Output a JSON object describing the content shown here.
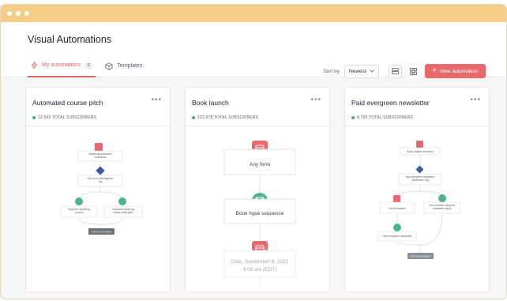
{
  "page": {
    "title": "Visual Automations"
  },
  "tabs": [
    {
      "label": "My automations",
      "count": "6",
      "icon": "lightning-icon",
      "active": true
    },
    {
      "label": "Templates",
      "icon": "cube-icon",
      "active": false
    }
  ],
  "toolbar": {
    "sort_label": "Sort by",
    "sort_value": "Newest",
    "new_button": "New automation",
    "accent": "#e9686b"
  },
  "cards": [
    {
      "title": "Automated course pitch",
      "subscribers": "12,542 TOTAL SUBSCRIBERS",
      "nodes": {
        "n1": "Sketching worksheet",
        "n1b": "download",
        "n2": "Yes I'm a total beginner",
        "n2b": "Tag",
        "n3": "Beginner sketching",
        "n3b": "content",
        "n4": "Advanced sketching",
        "n4b": "course sales pitch",
        "n5": "End of automation"
      }
    },
    {
      "title": "Book launch",
      "subscribers": "123,978 TOTAL SUBSCRIBERS",
      "nodes": {
        "n1": "Any form",
        "n2": "Book hype sequence",
        "n3": "Date: September 8, 2021",
        "n3b": "9:00 am (EDT)"
      }
    },
    {
      "title": "Paid evergreen newsletter",
      "subscribers": "4,760 TOTAL SUBSCRIBERS",
      "nodes": {
        "n1": "Book chapter download",
        "n2": "Has evergreen newsletter",
        "n2b": "Subscriber Tag",
        "n3": "Paid newsletter",
        "n4": "Free content evergreen",
        "n4b": "newsletter (stub)",
        "n5": "Paid evergreen newsletter",
        "n6": "End of automation"
      }
    }
  ],
  "colors": {
    "trigger": "#e9686b",
    "sequence": "#4db58a",
    "condition": "#3d5a9e",
    "status": "#3fae7a"
  }
}
